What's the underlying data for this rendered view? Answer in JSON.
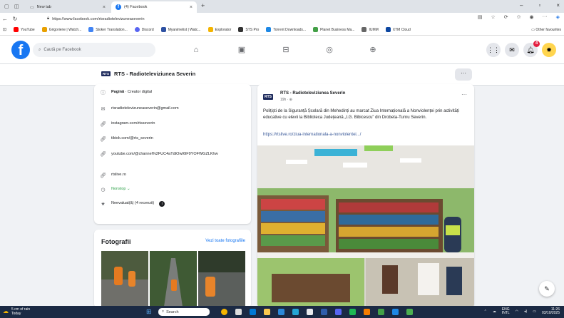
{
  "browser": {
    "tabs": [
      {
        "label": "New tab"
      },
      {
        "label": "(4) Facebook"
      }
    ],
    "new_tab_symbol": "+",
    "url": "https://www.facebook.com/rtsradiotelevizuneaseverin",
    "bookmarks": [
      {
        "label": "YouTube",
        "color": "#ff0000"
      },
      {
        "label": "Grigoriene | Watch...",
        "color": "#e8a000"
      },
      {
        "label": "Stoker Translation...",
        "color": "#4285f4"
      },
      {
        "label": "Discord",
        "color": "#5865f2"
      },
      {
        "label": "Myanimelist | Watc...",
        "color": "#2e51a2"
      },
      {
        "label": "Explorator",
        "color": "#f4b400"
      },
      {
        "label": "STS Pro",
        "color": "#333333"
      },
      {
        "label": "Torrent Downloads...",
        "color": "#1e88e5"
      },
      {
        "label": "Planet Business Ma...",
        "color": "#43a047"
      },
      {
        "label": "IUMM",
        "color": "#666666"
      },
      {
        "label": "XTM Cloud",
        "color": "#0d47a1"
      }
    ],
    "other_favorites": "Other favourites"
  },
  "facebook": {
    "search_placeholder": "Caută pe Facebook",
    "notifications_count": "4",
    "page_title": "RTS - Radioteleviziunea Severin",
    "more_symbol": "···",
    "intro": {
      "category_bold": "Pagină",
      "category_rest": " · Creator digital",
      "email": "rtsradiotelevizuneaseverin@gmail.com",
      "instagram": "instagram.com/rtsseverin",
      "tiktok": "tiktok.com/@rts_severin",
      "youtube": "youtube.com/@channel%2FUC4aTdtOwI6lF9YOFWGZLKhw",
      "website": "rtslive.ro",
      "hours": "Nonstop",
      "rating": "Neevaluat(ă) (4 recenzii)"
    },
    "photos": {
      "title": "Fotografii",
      "see_all": "Vezi toate fotografiile"
    },
    "post": {
      "author": "RTS - Radioteleviziunea Severin",
      "time": "19h · ",
      "text": "Polițiști de la Siguranță Școlară din Mehedinți au marcat Ziua Internațională a Nonviolenței prin activități educative cu elevii la Biblioteca Județeană „I.G. Bibicescu” din Drobeta-Turnu Severin.",
      "link": "https://rtslive.ro/ziua-internationala-a-nonviolentei.../"
    }
  },
  "taskbar": {
    "weather_temp": "5 cm of rain",
    "weather_sub": "Today",
    "search_label": "Search",
    "lang": "ENG",
    "lang_sub": "INTL",
    "time": "11:26",
    "date": "03/10/2025"
  },
  "colors": {
    "fb_blue": "#1877f2",
    "badge_red": "#e41e3f",
    "online_green": "#31a24c"
  }
}
